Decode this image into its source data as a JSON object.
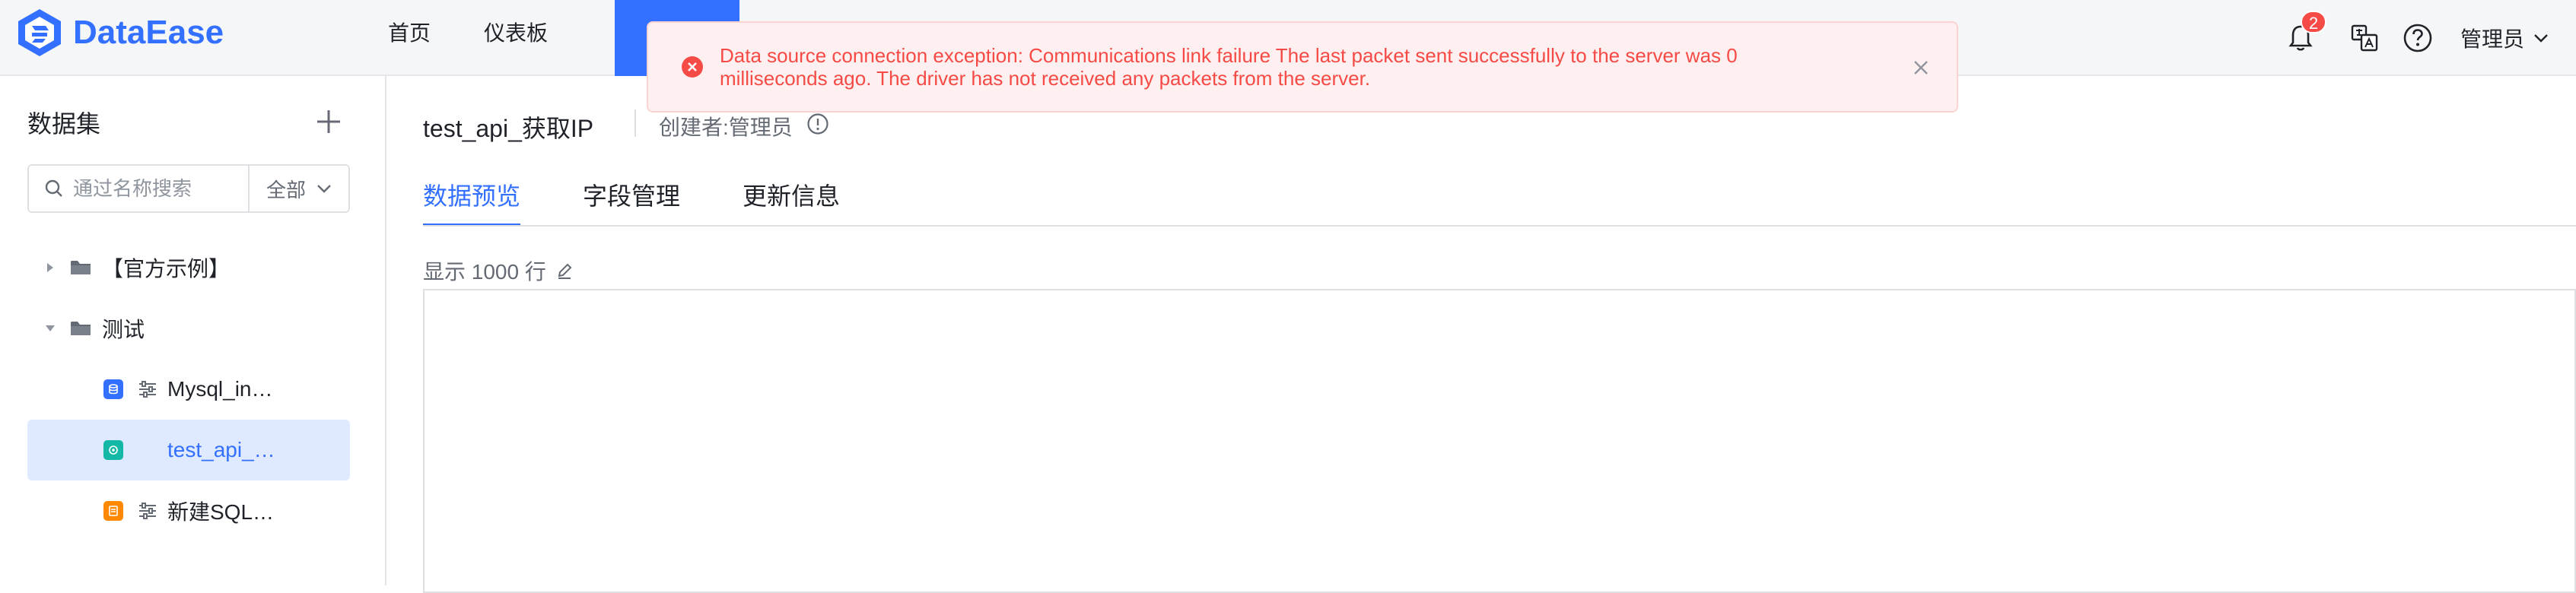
{
  "app": {
    "brand": "DataEase",
    "brand_color": "#3370ff"
  },
  "nav": {
    "items": [
      "首页",
      "仪表板"
    ]
  },
  "header": {
    "notification_count": "2",
    "user_name": "管理员"
  },
  "sidebar": {
    "title": "数据集",
    "search_placeholder": "通过名称搜索",
    "filter_label": "全部",
    "tree": [
      {
        "label": "【官方示例】",
        "expanded": false
      },
      {
        "label": "测试",
        "expanded": true,
        "children": [
          {
            "label": "Mysql_in…",
            "icon_color": "#3370ff"
          },
          {
            "label": "test_api_…",
            "icon_color": "#14b8a6",
            "selected": true
          },
          {
            "label": "新建SQL…",
            "icon_color": "#ff8800"
          }
        ]
      }
    ]
  },
  "main": {
    "dataset_title": "test_api_获取IP",
    "creator": "创建者:管理员",
    "tabs": [
      "数据预览",
      "字段管理",
      "更新信息"
    ],
    "active_tab": "数据预览",
    "rows_info": "显示 1000 行"
  },
  "toast": {
    "message": "Data source connection exception: Communications link failure The last packet sent successfully to the server was 0 milliseconds ago. The driver has not received any packets from the server.",
    "color": "#f54a45"
  }
}
